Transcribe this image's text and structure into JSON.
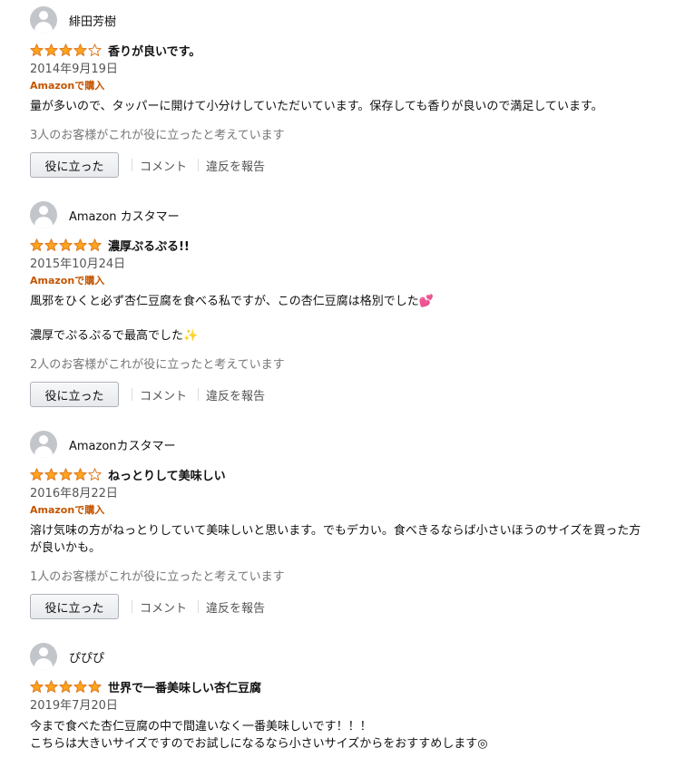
{
  "colors": {
    "star_fill": "#ffa41c",
    "star_stroke": "#de7921",
    "verified": "#c45500"
  },
  "icons": {
    "avatar": "default-user-avatar-icon",
    "star": "star-icon"
  },
  "reviews": [
    {
      "author": "緋田芳樹",
      "rating": 4,
      "title": "香りが良いです。",
      "date": "2014年9月19日",
      "verified": "Amazonで購入",
      "body": [
        "量が多いので、タッパーに開けて小分けしていただいています。保存しても香りが良いので満足しています。"
      ],
      "helpful_text": "3人のお客様がこれが役に立ったと考えています",
      "helpful_button": "役に立った",
      "comment_label": "コメント",
      "report_label": "違反を報告"
    },
    {
      "author": "Amazon カスタマー",
      "rating": 5,
      "title": "濃厚ぷるぷる!!",
      "date": "2015年10月24日",
      "verified": "Amazonで購入",
      "body": [
        "風邪をひくと必ず杏仁豆腐を食べる私ですが、この杏仁豆腐は格別でした💕",
        "濃厚でぷるぷるで最高でした✨"
      ],
      "helpful_text": "2人のお客様がこれが役に立ったと考えています",
      "helpful_button": "役に立った",
      "comment_label": "コメント",
      "report_label": "違反を報告"
    },
    {
      "author": "Amazonカスタマー",
      "rating": 4,
      "title": "ねっとりして美味しい",
      "date": "2016年8月22日",
      "verified": "Amazonで購入",
      "body": [
        "溶け気味の方がねっとりしていて美味しいと思います。でもデカい。食べきるならば小さいほうのサイズを買った方が良いかも。"
      ],
      "helpful_text": "1人のお客様がこれが役に立ったと考えています",
      "helpful_button": "役に立った",
      "comment_label": "コメント",
      "report_label": "違反を報告"
    },
    {
      "author": "ぴぴぴ",
      "rating": 5,
      "title": "世界で一番美味しい杏仁豆腐",
      "date": "2019年7月20日",
      "body": [
        "今まで食べた杏仁豆腐の中で間違いなく一番美味しいです！！！",
        "こちらは大きいサイズですのでお試しになるなら小さいサイズからをおすすめします◎"
      ]
    }
  ]
}
